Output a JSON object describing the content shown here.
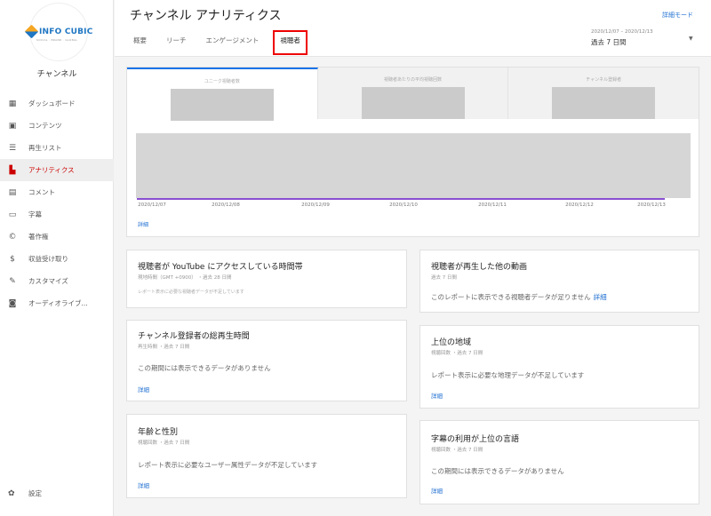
{
  "sidebar": {
    "logo_text": "INFO CUBIC",
    "logo_sub": "SOCIAL · BRAND · GLOBAL",
    "channel_label": "チャンネル",
    "items": [
      {
        "label": "ダッシュボード",
        "icon": "dashboard-icon"
      },
      {
        "label": "コンテンツ",
        "icon": "content-icon"
      },
      {
        "label": "再生リスト",
        "icon": "playlist-icon"
      },
      {
        "label": "アナリティクス",
        "icon": "analytics-icon"
      },
      {
        "label": "コメント",
        "icon": "comment-icon"
      },
      {
        "label": "字幕",
        "icon": "subtitles-icon"
      },
      {
        "label": "著作権",
        "icon": "copyright-icon"
      },
      {
        "label": "収益受け取り",
        "icon": "dollar-icon"
      },
      {
        "label": "カスタマイズ",
        "icon": "customize-icon"
      },
      {
        "label": "オーディオライブ...",
        "icon": "audio-library-icon"
      }
    ],
    "settings_label": "設定"
  },
  "header": {
    "title": "チャンネル アナリティクス",
    "detail_mode": "詳細モード",
    "tabs": [
      "概要",
      "リーチ",
      "エンゲージメント",
      "視聴者"
    ],
    "date_range": "2020/12/07 – 2020/12/13",
    "period": "過去 7 日間"
  },
  "top_card": {
    "metrics": [
      "ユニーク視聴者数",
      "視聴者あたりの平均視聴回数",
      "チャンネル登録者"
    ],
    "x_ticks": [
      "2020/12/07",
      "2020/12/08",
      "2020/12/09",
      "2020/12/10",
      "2020/12/11",
      "2020/12/12",
      "2020/12/13"
    ],
    "detail_link": "詳細"
  },
  "cards": {
    "youtube_time": {
      "title": "視聴者が YouTube にアクセスしている時間帯",
      "sub": "現地時間（GMT +0900） ・過去 28 日間",
      "note": "レポート表示に必要な視聴者データが不足しています"
    },
    "other_videos": {
      "title": "視聴者が再生した他の動画",
      "sub": "過去 7 日間",
      "note": "このレポートに表示できる視聴者データが足りません",
      "link": "詳細"
    },
    "subscriber_watch": {
      "title": "チャンネル登録者の総再生時間",
      "sub": "再生時間 ・過去 7 日間",
      "note": "この期間には表示できるデータがありません",
      "link": "詳細"
    },
    "top_regions": {
      "title": "上位の地域",
      "sub": "視聴回数 ・過去 7 日間",
      "note": "レポート表示に必要な地理データが不足しています",
      "link": "詳細"
    },
    "age_gender": {
      "title": "年齢と性別",
      "sub": "視聴回数 ・過去 7 日間",
      "note": "レポート表示に必要なユーザー属性データが不足しています",
      "link": "詳細"
    },
    "subtitle_languages": {
      "title": "字幕の利用が上位の言語",
      "sub": "視聴回数 ・過去 7 日間",
      "note": "この期間には表示できるデータがありません",
      "link": "詳細"
    }
  }
}
